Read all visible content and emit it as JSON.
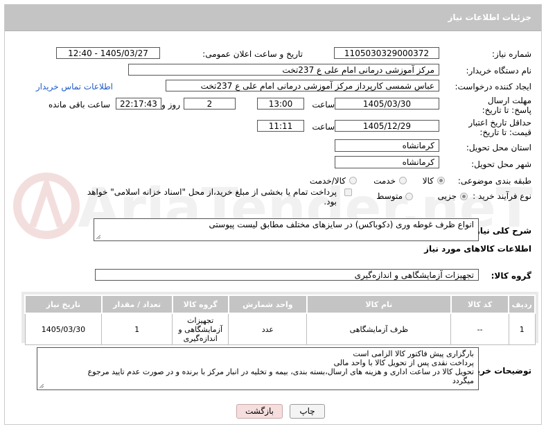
{
  "header": {
    "title": "جزئیات اطلاعات نیاز"
  },
  "fields": {
    "need_number": {
      "label": "شماره نیاز:",
      "value": "1105030329000372"
    },
    "announce_datetime": {
      "label": "تاریخ و ساعت اعلان عمومی:",
      "value": "1405/03/27 - 12:40"
    },
    "buyer_org": {
      "label": "نام دستگاه خریدار:",
      "value": "مرکز آموزشی درمانی امام علی ع 237تخت"
    },
    "requester": {
      "label": "ایجاد کننده درخواست:",
      "value": "عباس شمسی کارپرداز  مرکز آموزشی درمانی امام علی ع 237تخت",
      "contact_link": "اطلاعات تماس خریدار"
    },
    "reply_deadline": {
      "label": "مهلت ارسال پاسخ: تا تاریخ:",
      "date": "1405/03/30",
      "time_label": "ساعت",
      "time": "13:00",
      "days": "2",
      "days_label": "روز و",
      "remaining": "22:17:43",
      "remaining_label": "ساعت باقی مانده"
    },
    "price_validity": {
      "label": "حداقل تاریخ اعتبار قیمت: تا تاریخ:",
      "date": "1405/12/29",
      "time_label": "ساعت",
      "time": "11:11"
    },
    "delivery_province": {
      "label": "استان محل تحویل:",
      "value": "کرمانشاه"
    },
    "delivery_city": {
      "label": "شهر محل تحویل:",
      "value": "کرمانشاه"
    },
    "category": {
      "label": "طبقه بندی موضوعی:",
      "options": [
        "کالا",
        "خدمت",
        "کالا/خدمت"
      ],
      "selected": "کالا"
    },
    "process_type": {
      "label": "نوع فرآیند خرید :",
      "options": [
        "جزیی",
        "متوسط"
      ],
      "selected": "جزیی",
      "payment_note": "پرداخت تمام یا بخشی از مبلغ خرید،از محل \"اسناد خزانه اسلامی\" خواهد بود."
    }
  },
  "summary": {
    "label": "شرح کلی نیاز:",
    "value": "انواع ظرف غوطه وری (دکوباکس) در سایزهای مختلف مطابق لیست پیوستی"
  },
  "goods_section": {
    "title": "اطلاعات کالاهای مورد نیاز",
    "group_label": "گروه کالا:",
    "group_value": "تجهیزات آزمایشگاهی و اندازه‌گیری"
  },
  "table": {
    "headers": [
      "ردیف",
      "کد کالا",
      "نام کالا",
      "واحد شمارش",
      "گروه کالا",
      "تعداد / مقدار",
      "تاریخ نیاز"
    ],
    "rows": [
      {
        "row": "1",
        "code": "--",
        "name": "ظرف آزمایشگاهی",
        "unit": "عدد",
        "group": "تجهیزات آزمایشگاهی و اندازه‌گیری",
        "qty": "1",
        "date": "1405/03/30"
      }
    ]
  },
  "buyer_notes": {
    "label": "توضیحات خریدار:",
    "lines": [
      "بارگزاری پیش فاکتور کالا الزامی است",
      "پرداخت نقدی پس از تحویل کالا با واحد مالی",
      "تحویل کالا در ساعت اداری و هزینه های ارسال،بسته بندی، بیمه و تخلیه در انبار مرکز با برنده و در صورت عدم تایید مرجوع",
      "میگردد"
    ]
  },
  "buttons": {
    "print": "چاپ",
    "back": "بازگشت"
  },
  "colors": {
    "header_bg": "#c4c4c4",
    "link": "#1c5ac9",
    "back_button_bg": "#f6dede"
  }
}
